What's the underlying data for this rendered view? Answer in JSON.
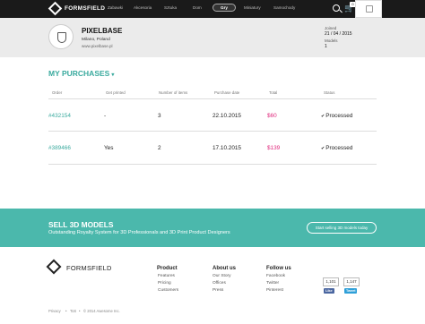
{
  "topbar": {
    "brand": "FORMSFIELD",
    "nav": [
      "Zabawki",
      "Akcesoria",
      "Sztuka",
      "Dom",
      "Gry",
      "Miniatury",
      "Samochody"
    ],
    "active_nav": "Gry",
    "cart_count": "0"
  },
  "profile": {
    "name": "PIXELBASE",
    "location": "Milano, Poland",
    "url": "www.pixelbase.pl",
    "joined_label": "Joined",
    "joined_value": "21 / 04 / 2015",
    "models_label": "Models",
    "models_value": "1"
  },
  "purchases": {
    "title": "MY PURCHASES",
    "columns": [
      "Order",
      "Get printed",
      "Number of items",
      "Purchase date",
      "Total",
      "Status"
    ],
    "rows": [
      {
        "order": "#432154",
        "printed": "-",
        "items": "3",
        "date": "22.10.2015",
        "total": "$60",
        "status": "Processed"
      },
      {
        "order": "#389466",
        "printed": "Yes",
        "items": "2",
        "date": "17.10.2015",
        "total": "$139",
        "status": "Processed"
      }
    ]
  },
  "banner": {
    "title": "SELL 3D MODELS",
    "subtitle": "Outstanding Royalty System for 3D Professionals and 3D Print Product Designers",
    "button": "Start selling 3D models today"
  },
  "footer": {
    "brand": "FORMSFIELD",
    "product": {
      "title": "Product",
      "links": [
        "Features",
        "Pricing",
        "Customers"
      ]
    },
    "about": {
      "title": "About us",
      "links": [
        "Our Story",
        "Offices",
        "Press"
      ]
    },
    "follow": {
      "title": "Follow us",
      "links": [
        "Facebook",
        "Twitter",
        "Pinterest"
      ]
    },
    "fb_count": "1,101",
    "tw_count": "1,147",
    "like_label": "Like",
    "tweet_label": "Tweet",
    "copyright_links": [
      "Privacy",
      "ToS"
    ],
    "copyright": "© 2014 Awesome Inc."
  },
  "colors": {
    "accent": "#3aaa9e",
    "banner": "#4bb8ac",
    "price": "#e0287c",
    "topbar": "#1a1a1a"
  }
}
